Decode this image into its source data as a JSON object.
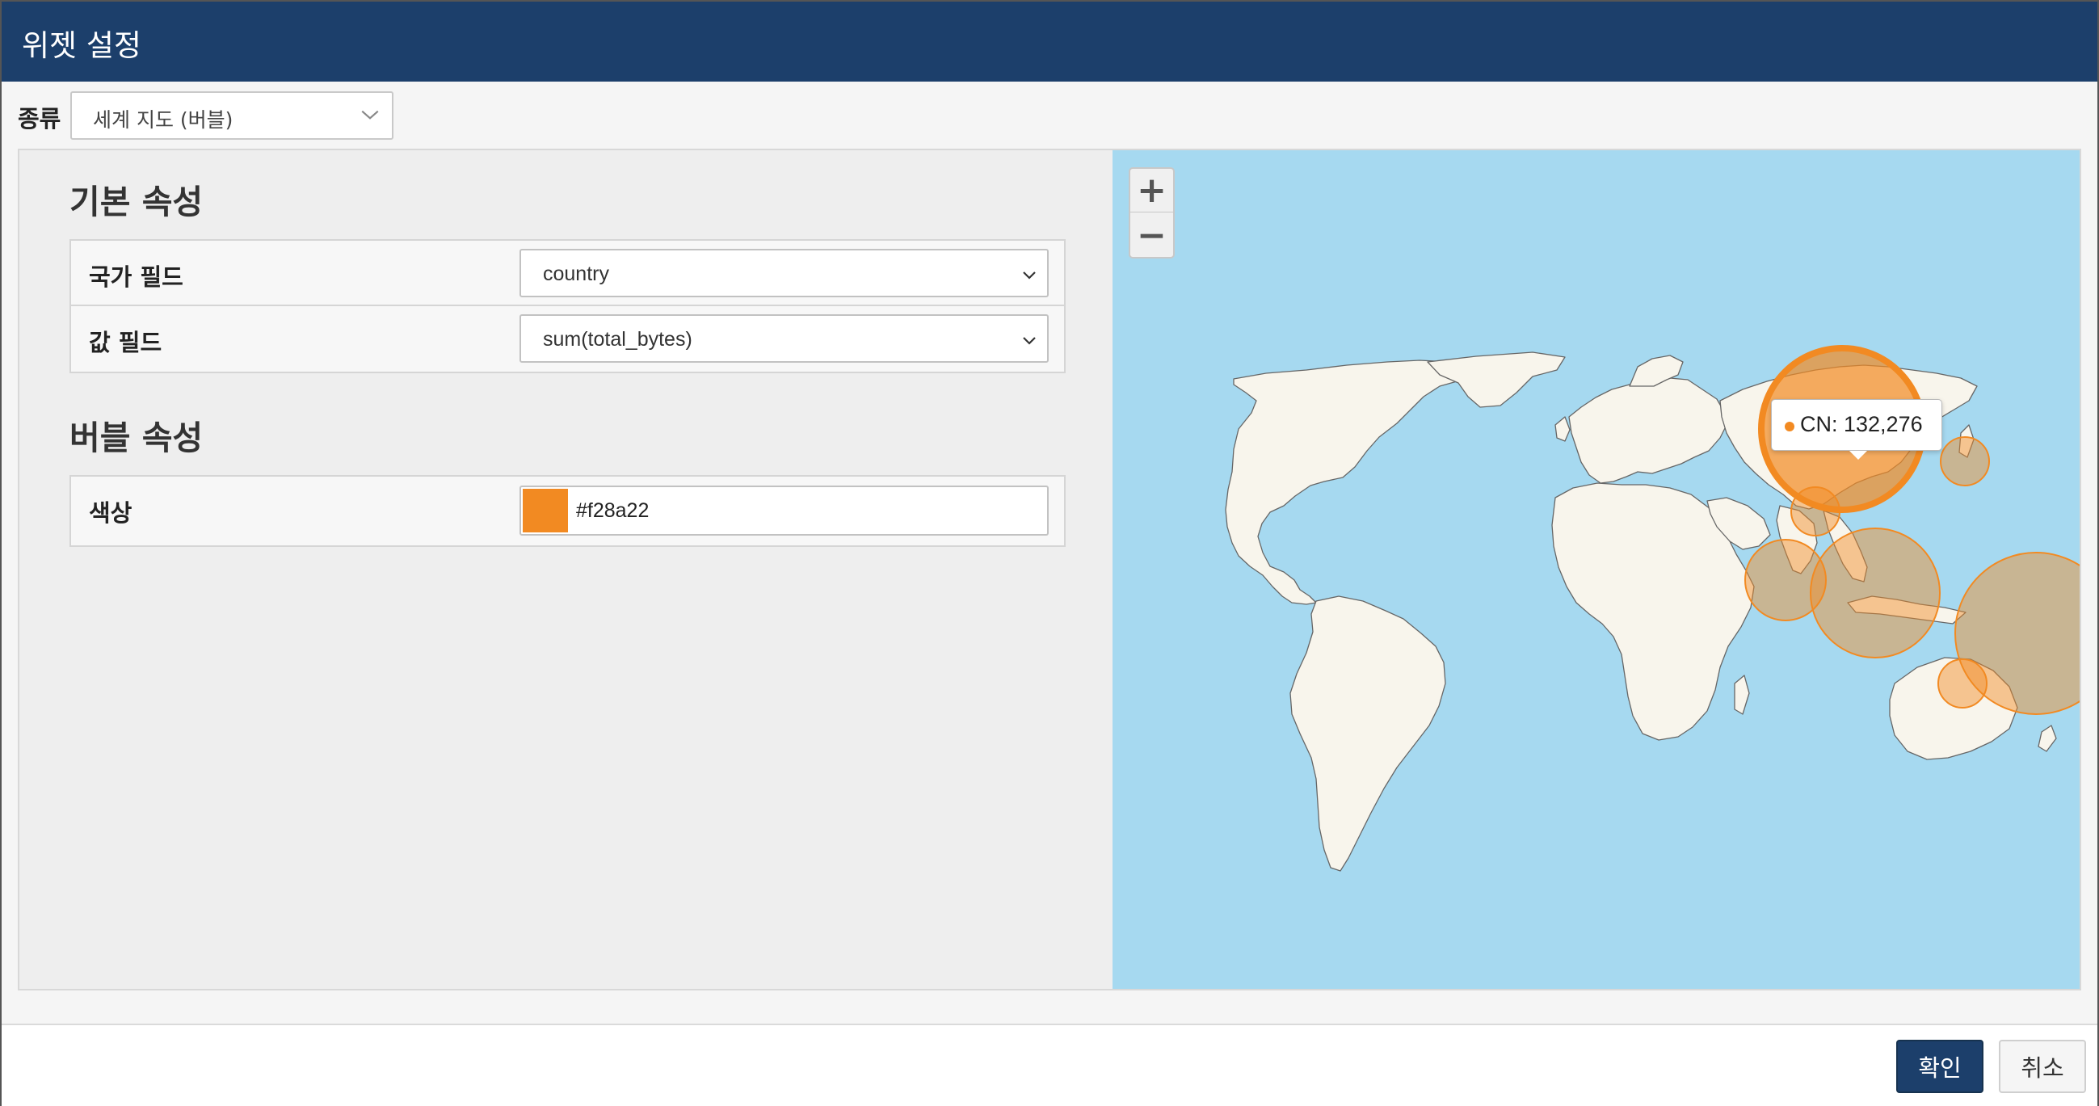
{
  "header": {
    "title": "위젯 설정"
  },
  "type_selector": {
    "label": "종류",
    "value": "세계 지도 (버블)"
  },
  "basic_props": {
    "title": "기본 속성",
    "rows": [
      {
        "label": "국가 필드",
        "value": "country"
      },
      {
        "label": "값 필드",
        "value": "sum(total_bytes)"
      }
    ]
  },
  "bubble_props": {
    "title": "버블 속성",
    "color_label": "색상",
    "color_value": "#f28a22"
  },
  "map": {
    "zoom_in": "+",
    "zoom_out": "−",
    "tooltip": "CN: 132,276",
    "ocean_color": "#a6d9f0",
    "land_color": "#f8f5ec",
    "bubble_color": "#f28a22"
  },
  "footer": {
    "ok_label": "확인",
    "cancel_label": "취소"
  }
}
